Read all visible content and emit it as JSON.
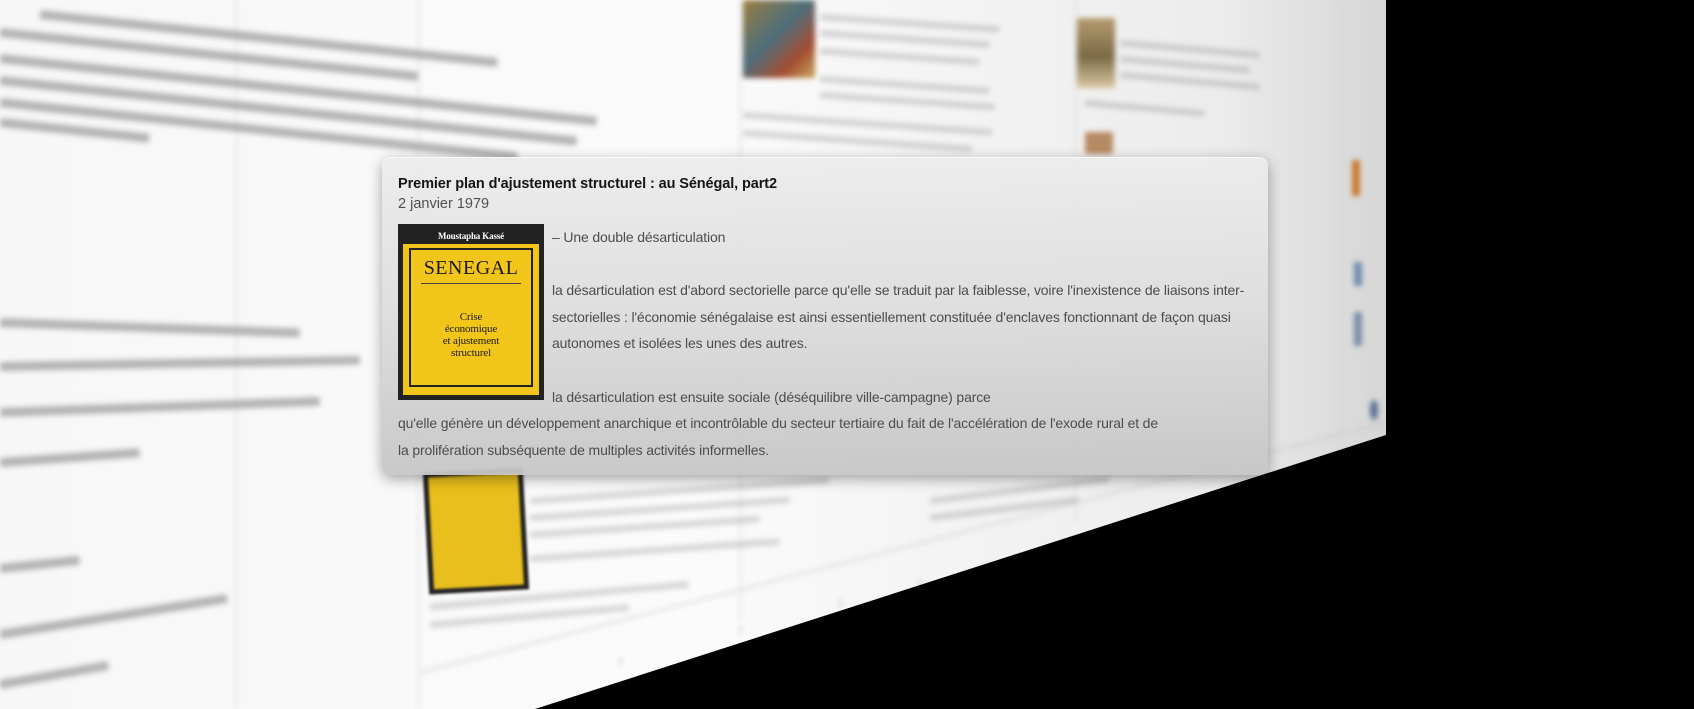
{
  "event": {
    "title": "Premier plan d'ajustement structurel : au Sénégal, part2",
    "date": "2 janvier 1979",
    "heading_line": "– Une double désarticulation",
    "paragraph_1": "la désarticulation est d'abord sectorielle parce qu'elle se traduit par la faiblesse, voire l'inexistence de liaisons inter-sectorielles : l'économie sénégalaise est ainsi essentiellement constituée d'enclaves fonctionnant de façon quasi autonomes et isolées les unes des autres.",
    "paragraph_2_line_1": "la désarticulation est ensuite sociale (déséquilibre ville-campagne) parce",
    "paragraph_2_line_2": "qu'elle génère un développement anarchique et incontrôlable du secteur tertiaire du fait de l'accélération de l'exode rural et de",
    "paragraph_2_line_3": "la prolifération subséquente de multiples activités informelles."
  },
  "book": {
    "author": "Moustapha Kassé",
    "title": "SENEGAL",
    "subtitle_1": "Crise",
    "subtitle_2": "économique",
    "subtitle_3": "et ajustement",
    "subtitle_4": "structurel",
    "cover_color": "#f2c51b"
  },
  "colors": {
    "card_background": "#e2e2e2",
    "outside_background": "#000000"
  }
}
